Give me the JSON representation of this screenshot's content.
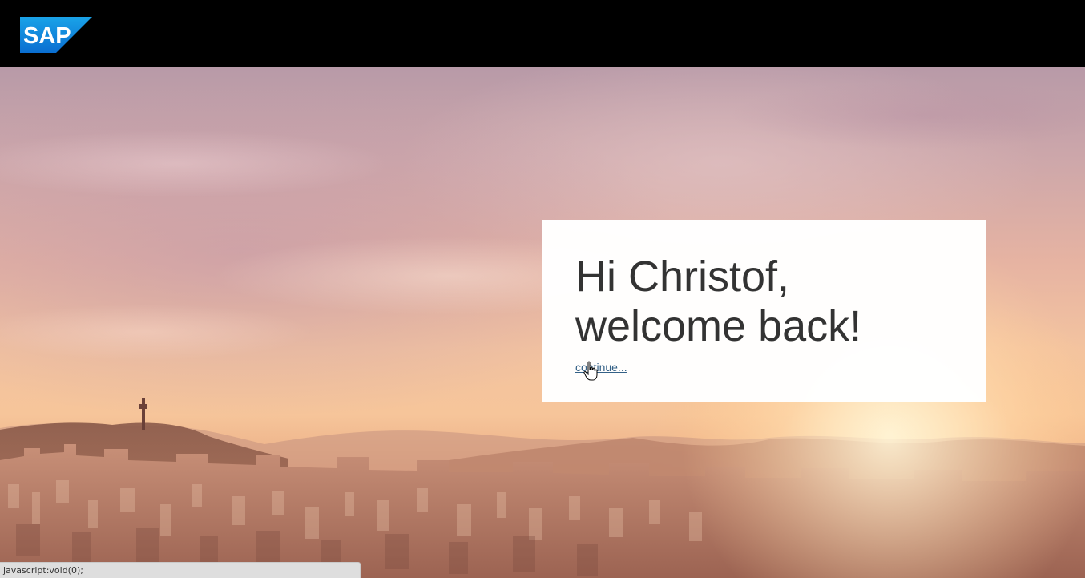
{
  "header": {
    "logo_text": "SAP",
    "logo_color": "#0a6ed1"
  },
  "welcome": {
    "greeting_line1": "Hi Christof,",
    "greeting_line2": "welcome back!",
    "continue_label": "continue..."
  },
  "cursor": {
    "icon": "hand-pointer-icon"
  },
  "status_bar": {
    "text": "javascript:void(0);"
  }
}
